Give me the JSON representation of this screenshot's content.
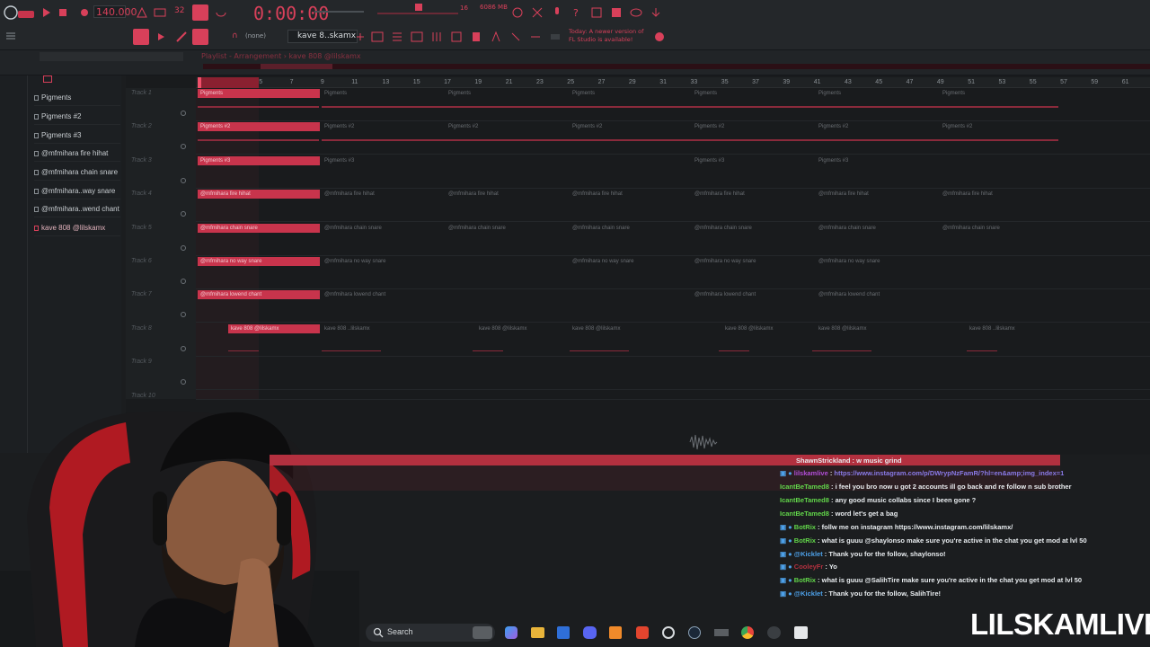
{
  "toolbar": {
    "tempo": "140.000",
    "time": "0:00:00",
    "time_small": "16",
    "cpu_mem": "6086 MB",
    "pattern_name": "kave 8..skamx",
    "snap": "(none)",
    "hint_line1": "Today: A newer version of",
    "hint_line2": "FL Studio is available!"
  },
  "playlist": {
    "breadcrumb": "Playlist - Arrangement › kave 808 @lilskamx",
    "ruler": [
      "3",
      "5",
      "7",
      "9",
      "11",
      "13",
      "15",
      "17",
      "19",
      "21",
      "23",
      "25",
      "27",
      "29",
      "31",
      "33",
      "35",
      "37",
      "39",
      "41",
      "43",
      "45",
      "47",
      "49",
      "51",
      "53",
      "55",
      "57",
      "59",
      "61"
    ],
    "track_labels": [
      "Track 1",
      "Track 2",
      "Track 3",
      "Track 4",
      "Track 5",
      "Track 6",
      "Track 7",
      "Track 8",
      "Track 9",
      "Track 10"
    ]
  },
  "browser": {
    "items": [
      "Pigments",
      "Pigments #2",
      "Pigments #3",
      "@mfmihara fire hihat",
      "@mfmihara chain snare",
      "@mfmihara..way snare",
      "@mfmihara..wend chant",
      "kave 808 @lilskamx"
    ]
  },
  "clips": {
    "t1": "Pigments",
    "t2": "Pigments #2",
    "t3": "Pigments #3",
    "t4": "@mfmihara fire hihat",
    "t5": "@mfmihara chain snare",
    "t6": "@mfmihara no way snare",
    "t7": "@mfmihara lowend chant",
    "t8": "kave 808 @lilskamx",
    "t8b": "kave 808 ..lilskamx",
    "t8c": "kave 808 @lilskamx"
  },
  "chat": [
    {
      "user": "ShawnStrickland",
      "sep": " : ",
      "msg": "w music grind",
      "color": "#e9edf0"
    },
    {
      "user": "lilskamlive",
      "sep": " : ",
      "msg": "https://www.instagram.com/p/DWrypNzFamR/?hl=en&amp;img_index=1",
      "color": "#b04dd6"
    },
    {
      "user": "IcantBeTamed8",
      "sep": " : ",
      "msg": "i feel you bro now u got 2 accounts ill go back and re follow n sub brother",
      "color": "#62d64a"
    },
    {
      "user": "IcantBeTamed8",
      "sep": " : ",
      "msg": "any good music collabs since I been gone ?",
      "color": "#62d64a"
    },
    {
      "user": "IcantBeTamed8",
      "sep": " : ",
      "msg": "word let's get a bag",
      "color": "#62d64a"
    },
    {
      "user": "BotRix",
      "sep": " : ",
      "msg": "follw me on instagram https://www.instagram.com/lilskamx/",
      "color": "#62d64a"
    },
    {
      "user": "BotRix",
      "sep": " : ",
      "msg": "what is guuu @shaylonso make sure you're active in the chat you get mod at lvl 50",
      "color": "#62d64a"
    },
    {
      "user": "@Kicklet",
      "sep": " : ",
      "msg": "Thank you for the follow, shaylonso!",
      "color": "#4da0e8"
    },
    {
      "user": "CooleyFr",
      "sep": " : ",
      "msg": "Yo",
      "color": "#b3303f"
    },
    {
      "user": "BotRix",
      "sep": " : ",
      "msg": "what is guuu @SalihTire make sure you're active in the chat you get mod at lvl 50",
      "color": "#62d64a"
    },
    {
      "user": "@Kicklet",
      "sep": " : ",
      "msg": "Thank you for the follow, SalihTire!",
      "color": "#4da0e8"
    }
  ],
  "taskbar": {
    "search_label": "Search"
  },
  "brand": "LILSKAMLIVE",
  "colors": {
    "accent": "#d8405a",
    "clip": "#c8344c",
    "bg": "#1b1d1f"
  }
}
